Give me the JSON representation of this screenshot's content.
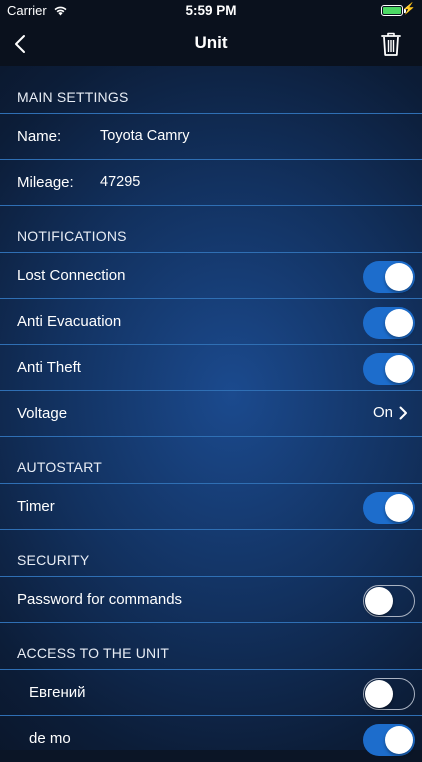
{
  "status_bar": {
    "carrier": "Carrier",
    "time": "5:59 PM"
  },
  "nav": {
    "title": "Unit",
    "back_icon": "chevron-left-icon",
    "delete_icon": "trash-icon"
  },
  "main_settings": {
    "header": "MAIN SETTINGS",
    "name_label": "Name:",
    "name_value": "Toyota Camry",
    "mileage_label": "Mileage:",
    "mileage_value": "47295"
  },
  "notifications": {
    "header": "NOTIFICATIONS",
    "lost_connection": {
      "label": "Lost Connection",
      "on": true
    },
    "anti_evacuation": {
      "label": "Anti Evacuation",
      "on": true
    },
    "anti_theft": {
      "label": "Anti Theft",
      "on": true
    },
    "voltage": {
      "label": "Voltage",
      "value": "On"
    }
  },
  "autostart": {
    "header": "AUTOSTART",
    "timer": {
      "label": "Timer",
      "on": true
    }
  },
  "security": {
    "header": "SECURITY",
    "password": {
      "label": "Password for commands",
      "on": false
    }
  },
  "access": {
    "header": "ACCESS TO THE UNIT",
    "users": [
      {
        "name": "Евгений",
        "on": false
      },
      {
        "name": "de mo",
        "on": true
      }
    ]
  },
  "colors": {
    "toggle_on": "#1d6dcc",
    "separator": "#2f6fb4",
    "battery": "#4cd964"
  }
}
